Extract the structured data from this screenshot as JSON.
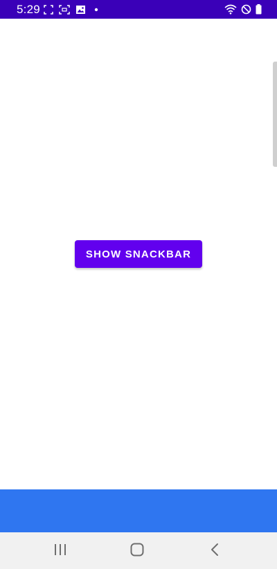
{
  "status_bar": {
    "time": "5:29",
    "background": "#3a00b8",
    "left_icons": [
      "screenshot-frame-icon",
      "screen-record-icon",
      "image-icon",
      "notification-dot-icon"
    ],
    "right_icons": [
      "wifi-icon",
      "do-not-disturb-icon",
      "battery-icon"
    ]
  },
  "main": {
    "show_snackbar_label": "SHOW SNACKBAR",
    "button_color": "#6200ee"
  },
  "bottom_bar": {
    "color": "#2f76f0"
  },
  "nav_bar": {
    "buttons": [
      "recents-icon",
      "home-icon",
      "back-icon"
    ]
  }
}
